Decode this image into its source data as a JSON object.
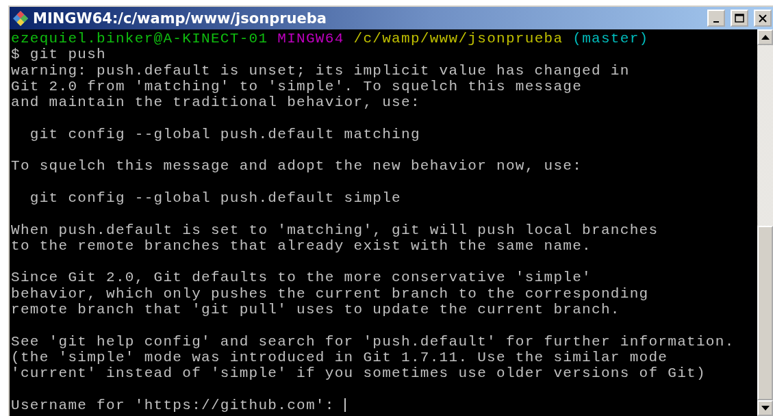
{
  "window": {
    "title": "MINGW64:/c/wamp/www/jsonprueba"
  },
  "terminal": {
    "prompt": {
      "user_host": "ezequiel.binker@A-KINECT-01",
      "system": "MINGW64",
      "path": "/c/wamp/www/jsonprueba",
      "branch": "(master)"
    },
    "command": "$ git push",
    "output_blocks": [
      [
        "warning: push.default is unset; its implicit value has changed in",
        "Git 2.0 from 'matching' to 'simple'. To squelch this message",
        "and maintain the traditional behavior, use:"
      ],
      [
        "  git config --global push.default matching"
      ],
      [
        "To squelch this message and adopt the new behavior now, use:"
      ],
      [
        "  git config --global push.default simple"
      ],
      [
        "When push.default is set to 'matching', git will push local branches",
        "to the remote branches that already exist with the same name."
      ],
      [
        "Since Git 2.0, Git defaults to the more conservative 'simple'",
        "behavior, which only pushes the current branch to the corresponding",
        "remote branch that 'git pull' uses to update the current branch."
      ],
      [
        "See 'git help config' and search for 'push.default' for further information.",
        "(the 'simple' mode was introduced in Git 1.7.11. Use the similar mode",
        "'current' instead of 'simple' if you sometimes use older versions of Git)"
      ]
    ],
    "input_prompt": "Username for 'https://github.com': "
  }
}
